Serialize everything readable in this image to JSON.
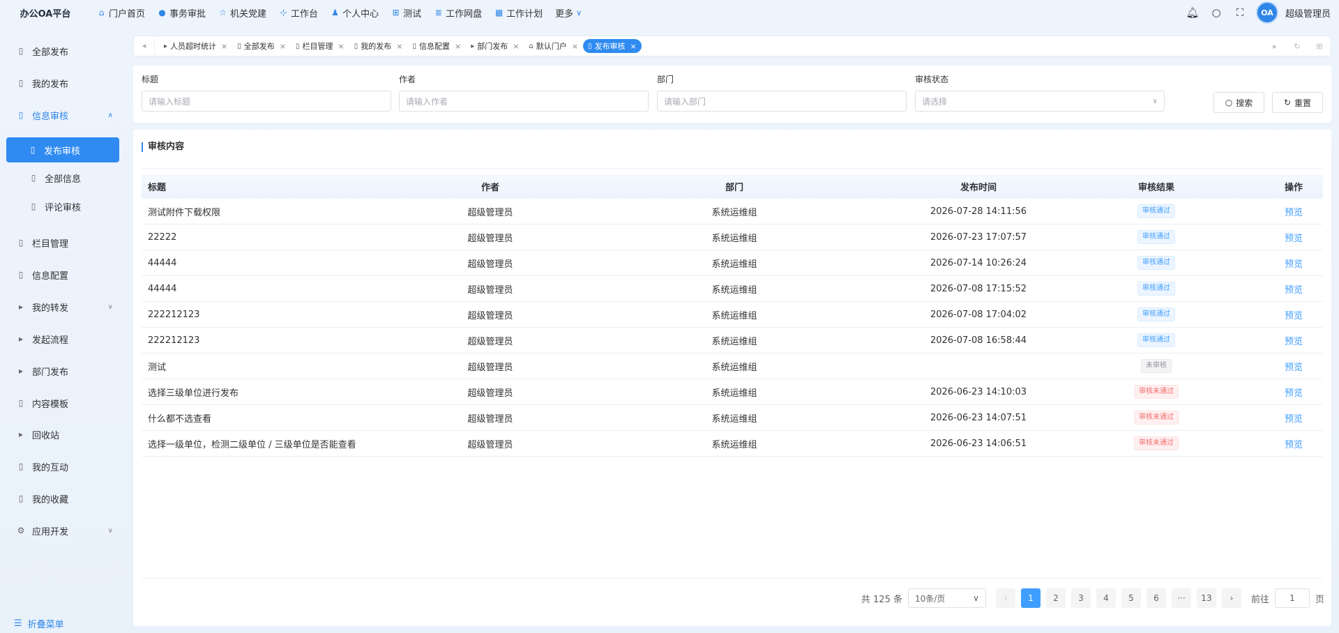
{
  "brand": "办公OA平台",
  "topnav": [
    {
      "label": "门户首页",
      "icon": "home-icon"
    },
    {
      "label": "事务审批",
      "icon": "info-circle-icon"
    },
    {
      "label": "机关党建",
      "icon": "star-icon"
    },
    {
      "label": "工作台",
      "icon": "org-chart-icon"
    },
    {
      "label": "个人中心",
      "icon": "user-icon"
    },
    {
      "label": "测试",
      "icon": "grid-table-icon"
    },
    {
      "label": "工作网盘",
      "icon": "database-icon"
    },
    {
      "label": "工作计划",
      "icon": "calendar-icon"
    }
  ],
  "more_label": "更多",
  "user": {
    "avatar_text": "OA",
    "name": "超级管理员"
  },
  "sidebar": {
    "items": [
      {
        "label": "全部发布",
        "icon": "document-icon"
      },
      {
        "label": "我的发布",
        "icon": "document-icon"
      },
      {
        "label": "信息审核",
        "icon": "document-icon"
      },
      {
        "label": "发布审核",
        "icon": "document-icon"
      },
      {
        "label": "全部信息",
        "icon": "document-icon"
      },
      {
        "label": "评论审核",
        "icon": "document-icon"
      },
      {
        "label": "栏目管理",
        "icon": "document-icon"
      },
      {
        "label": "信息配置",
        "icon": "document-icon"
      },
      {
        "label": "我的转发",
        "icon": "caret-right-icon"
      },
      {
        "label": "发起流程",
        "icon": "caret-right-icon"
      },
      {
        "label": "部门发布",
        "icon": "caret-right-icon"
      },
      {
        "label": "内容模板",
        "icon": "document-icon"
      },
      {
        "label": "回收站",
        "icon": "caret-right-icon"
      },
      {
        "label": "我的互动",
        "icon": "document-icon"
      },
      {
        "label": "我的收藏",
        "icon": "document-icon"
      },
      {
        "label": "应用开发",
        "icon": "gear-icon"
      }
    ],
    "collapse_label": "折叠菜单"
  },
  "tabs": [
    {
      "label": "人员超时统计"
    },
    {
      "label": "全部发布"
    },
    {
      "label": "栏目管理"
    },
    {
      "label": "我的发布"
    },
    {
      "label": "信息配置"
    },
    {
      "label": "部门发布"
    },
    {
      "label": "默认门户"
    },
    {
      "label": "发布审核"
    }
  ],
  "filter": {
    "title_label": "标题",
    "title_placeholder": "请输入标题",
    "author_label": "作者",
    "author_placeholder": "请输入作者",
    "dept_label": "部门",
    "dept_placeholder": "请输入部门",
    "status_label": "审核状态",
    "status_placeholder": "请选择",
    "search_label": "搜索",
    "reset_label": "重置"
  },
  "section_title": "审核内容",
  "table": {
    "headers": [
      "标题",
      "作者",
      "部门",
      "发布时间",
      "审核结果",
      "操作"
    ],
    "rows": [
      {
        "title": "测试附件下载权限",
        "author": "超级管理员",
        "dept": "系统运维组",
        "time": "2026-07-28 14:11:56",
        "result": "审核通过",
        "status": "pass",
        "action": "预览"
      },
      {
        "title": "22222",
        "author": "超级管理员",
        "dept": "系统运维组",
        "time": "2026-07-23 17:07:57",
        "result": "审核通过",
        "status": "pass",
        "action": "预览"
      },
      {
        "title": "44444",
        "author": "超级管理员",
        "dept": "系统运维组",
        "time": "2026-07-14 10:26:24",
        "result": "审核通过",
        "status": "pass",
        "action": "预览"
      },
      {
        "title": "44444",
        "author": "超级管理员",
        "dept": "系统运维组",
        "time": "2026-07-08 17:15:52",
        "result": "审核通过",
        "status": "pass",
        "action": "预览"
      },
      {
        "title": "222212123",
        "author": "超级管理员",
        "dept": "系统运维组",
        "time": "2026-07-08 17:04:02",
        "result": "审核通过",
        "status": "pass",
        "action": "预览"
      },
      {
        "title": "222212123",
        "author": "超级管理员",
        "dept": "系统运维组",
        "time": "2026-07-08 16:58:44",
        "result": "审核通过",
        "status": "pass",
        "action": "预览"
      },
      {
        "title": "测试",
        "author": "超级管理员",
        "dept": "系统运维组",
        "time": "",
        "result": "未审核",
        "status": "pending",
        "action": "预览"
      },
      {
        "title": "选择三级单位进行发布",
        "author": "超级管理员",
        "dept": "系统运维组",
        "time": "2026-06-23 14:10:03",
        "result": "审核未通过",
        "status": "fail",
        "action": "预览"
      },
      {
        "title": "什么都不选查看",
        "author": "超级管理员",
        "dept": "系统运维组",
        "time": "2026-06-23 14:07:51",
        "result": "审核未通过",
        "status": "fail",
        "action": "预览"
      },
      {
        "title": "选择一级单位，检测二级单位 / 三级单位是否能查看",
        "author": "超级管理员",
        "dept": "系统运维组",
        "time": "2026-06-23 14:06:51",
        "result": "审核未通过",
        "status": "fail",
        "action": "预览"
      }
    ]
  },
  "pagination": {
    "total": "共 125 条",
    "page_size": "10条/页",
    "pages": [
      "1",
      "2",
      "3",
      "4",
      "5",
      "6",
      "···",
      "13"
    ],
    "current": "1",
    "goto_label": "前往",
    "goto_value": "1",
    "goto_suffix": "页"
  },
  "colors": {
    "accent": "#2f8bf1",
    "pass": "#409eff",
    "fail": "#f56c6c",
    "pending": "#909399"
  }
}
